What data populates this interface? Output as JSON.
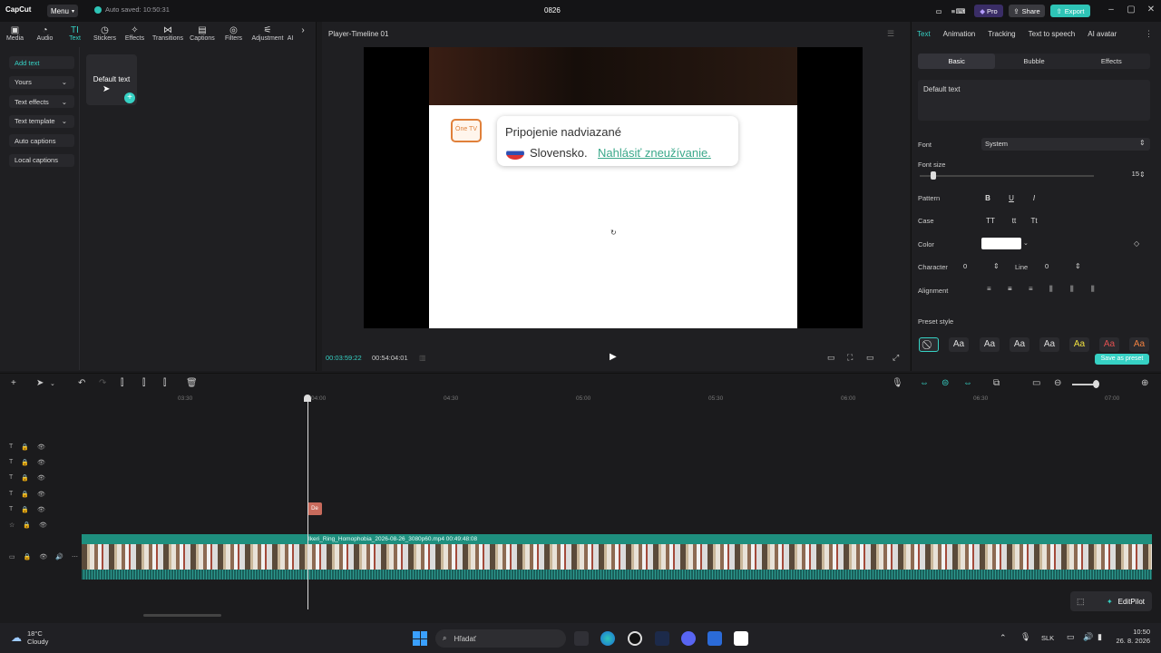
{
  "app": {
    "logo": "CapCut",
    "menu_label": "Menu",
    "autosave": "Auto saved: 10:50:31",
    "project_title": "0826",
    "pro_label": "Pro",
    "share_label": "Share",
    "export_label": "Export"
  },
  "media_toolbar": {
    "items": [
      "Media",
      "Audio",
      "Text",
      "Stickers",
      "Effects",
      "Transitions",
      "Captions",
      "Filters",
      "Adjustment",
      "AI"
    ]
  },
  "side_menu": {
    "items": [
      "Add text",
      "Yours",
      "Text effects",
      "Text template",
      "Auto captions",
      "Local captions"
    ]
  },
  "text_panel": {
    "card_label": "Default text"
  },
  "player": {
    "title": "Player-Timeline 01",
    "current_time": "00:03:59:22",
    "total_time": "00:54:04:01",
    "overlay": {
      "icon_text": "Óne TV",
      "line1": "Pripojenie nadviazané",
      "line2_prefix": "Slovensko.",
      "line2_link": "Nahlásiť zneužívanie."
    }
  },
  "right_panel": {
    "tabs": [
      "Text",
      "Animation",
      "Tracking",
      "Text to speech",
      "AI avatar"
    ],
    "subtabs": [
      "Basic",
      "Bubble",
      "Effects"
    ],
    "text_value": "Default text",
    "labels": {
      "font": "Font",
      "font_size": "Font size",
      "pattern": "Pattern",
      "case": "Case",
      "color": "Color",
      "character": "Character",
      "line": "Line",
      "alignment": "Alignment",
      "preset_style": "Preset style"
    },
    "font_value": "System",
    "font_size_value": "15",
    "font_size_level": 0.08,
    "pattern_buttons": [
      "B",
      "U",
      "I"
    ],
    "case_buttons": [
      "TT",
      "tt",
      "Tt"
    ],
    "color_value": "#ffffff",
    "character_value": "0",
    "line_value": "0",
    "presets": [
      "⃠",
      "Aa",
      "Aa",
      "Aa",
      "Aa",
      "Aa",
      "Aa",
      "Aa"
    ],
    "save_preset": "Save as preset"
  },
  "timeline": {
    "ticks": [
      "03:30",
      "04:00",
      "04:30",
      "05:00",
      "05:30",
      "06:00",
      "06:30",
      "07:00"
    ],
    "video_clip_label": "Ikeri_Ring_Homophobia_2026-08-26_3080p60.mp4   00:49:48:08",
    "marker_text": "De",
    "editpilot": "EditPilot"
  },
  "taskbar": {
    "temp": "18°C",
    "weather": "Cloudy",
    "search_placeholder": "Hľadať",
    "lang": "SLK",
    "time": "10:50",
    "date": "26. 8. 2026"
  },
  "colors": {
    "accent": "#36d1c4",
    "pro": "#7b5cff",
    "export": "#2ec4b6"
  }
}
